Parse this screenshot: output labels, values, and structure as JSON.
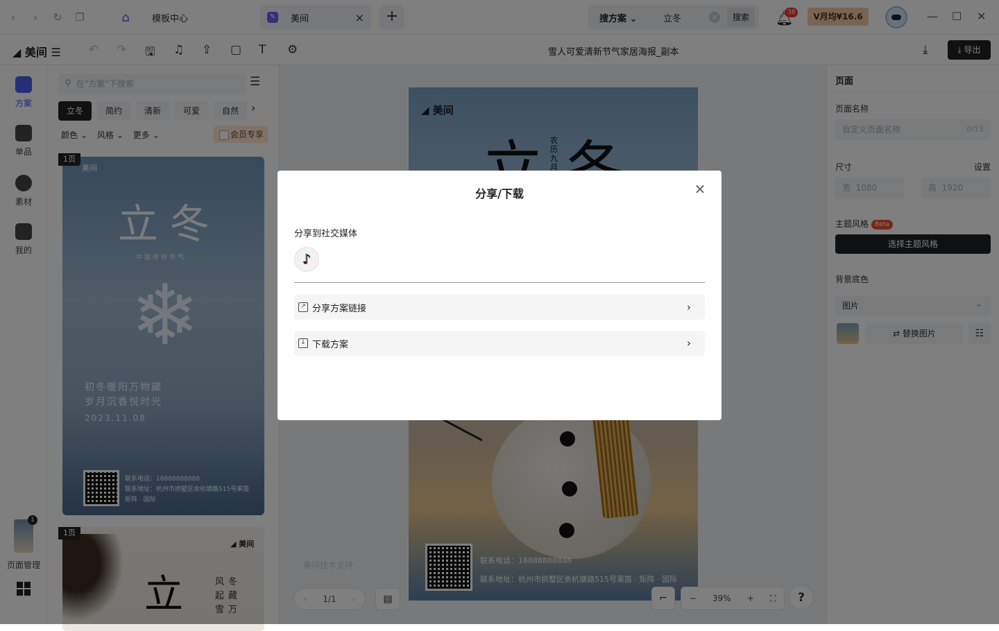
{
  "titlebar": {
    "home_tab_label": "模板中心",
    "active_tab_label": "美间",
    "search_scope": "搜方案",
    "search_value": "立冬",
    "search_button": "搜索",
    "notification_count": "38",
    "vip_label": "V月均¥16.6"
  },
  "editor": {
    "logo": "美间",
    "doc_title": "雪人可爱清新节气家居海报_副本",
    "export_label": "导出"
  },
  "rail": {
    "items": [
      {
        "label": "方案"
      },
      {
        "label": "单品"
      },
      {
        "label": "素材"
      },
      {
        "label": "我的"
      }
    ],
    "page_manage_label": "页面管理",
    "page_manage_count": "1"
  },
  "panel": {
    "search_placeholder": "在\"方案\"下搜索",
    "chips": [
      "立冬",
      "简约",
      "清新",
      "可爱",
      "自然"
    ],
    "filters": [
      "颜色",
      "风格",
      "更多"
    ],
    "member_only": "会员专享",
    "cards": [
      {
        "page_tag": "1页",
        "brand": "美间",
        "title": "立冬",
        "subtitle": "中国传统节气",
        "line1": "初冬暖阳万物藏",
        "line2": "岁月沉香悦时光",
        "date": "2023.11.08",
        "contact": "联系电话：16888888888",
        "address": "联系地址：杭州市拱墅区余杭塘路515号莱茵矩阵 · 国际"
      },
      {
        "page_tag": "1页",
        "brand": "美间",
        "title": "立",
        "poem": "风冬起藏雪万"
      }
    ]
  },
  "canvas": {
    "brand": "美间",
    "title": "立冬",
    "vertical": "农历九月",
    "tel": "联系电话：16888888888",
    "addr": "联系地址：杭州市拱墅区余杭塘路515号莱茵 · 矩阵 · 国际",
    "watermark": "美间技术支持",
    "page_indicator": "1/1",
    "zoom": "39%"
  },
  "right_panel": {
    "header": "页面",
    "page_name_label": "页面名称",
    "page_name_placeholder": "自定义页面名称",
    "page_name_count": "0/15",
    "size_label": "尺寸",
    "size_setting": "设置",
    "width_label": "宽",
    "width_value": "1080",
    "height_label": "高",
    "height_value": "1920",
    "theme_label": "主题风格",
    "beta": "Beta",
    "theme_button": "选择主题风格",
    "bg_label": "背景底色",
    "bg_type": "图片",
    "replace_image": "⇄ 替换图片"
  },
  "modal": {
    "title": "分享/下载",
    "social_label": "分享到社交媒体",
    "share_link": "分享方案链接",
    "download": "下载方案"
  }
}
